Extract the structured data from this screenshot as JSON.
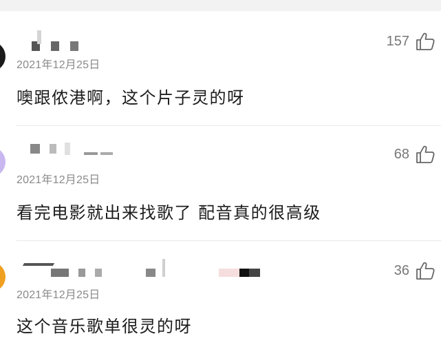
{
  "topbar": {
    "partial_text": ""
  },
  "comments": [
    {
      "date": "2021年12月25日",
      "text": "噢跟侬港啊，这个片子灵的呀",
      "likes": "157",
      "avatar_color": "#1a1a1a"
    },
    {
      "date": "2021年12月25日",
      "text": "看完电影就出来找歌了 配音真的很高级",
      "likes": "68",
      "avatar_color": "#c9b8f0"
    },
    {
      "date": "2021年12月25日",
      "text": "这个音乐歌单很灵的呀",
      "likes": "36",
      "avatar_color": "#f0a020"
    }
  ],
  "icons": {
    "like": "thumbs-up-icon"
  }
}
